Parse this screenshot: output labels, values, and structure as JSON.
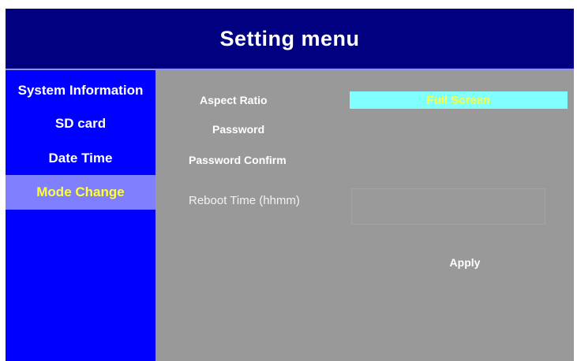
{
  "header": {
    "title": "Setting menu"
  },
  "sidebar": {
    "items": [
      {
        "label": "System Information",
        "active": false
      },
      {
        "label": "SD card",
        "active": false
      },
      {
        "label": "Date Time",
        "active": false
      },
      {
        "label": "Mode Change",
        "active": true
      }
    ]
  },
  "form": {
    "aspect_ratio": {
      "label": "Aspect Ratio",
      "value": "Full Screen"
    },
    "password": {
      "label": "Password",
      "value": ""
    },
    "password_confirm": {
      "label": "Password Confirm",
      "value": ""
    },
    "reboot_time": {
      "label": "Reboot Time (hhmm)",
      "value": ""
    },
    "apply_label": "Apply"
  },
  "colors": {
    "header_bg": "#000080",
    "sidebar_bg": "#0000ff",
    "sidebar_active_bg": "#8080ff",
    "active_text": "#ffff33",
    "content_bg": "#999999",
    "select_bg": "#80ffff"
  }
}
